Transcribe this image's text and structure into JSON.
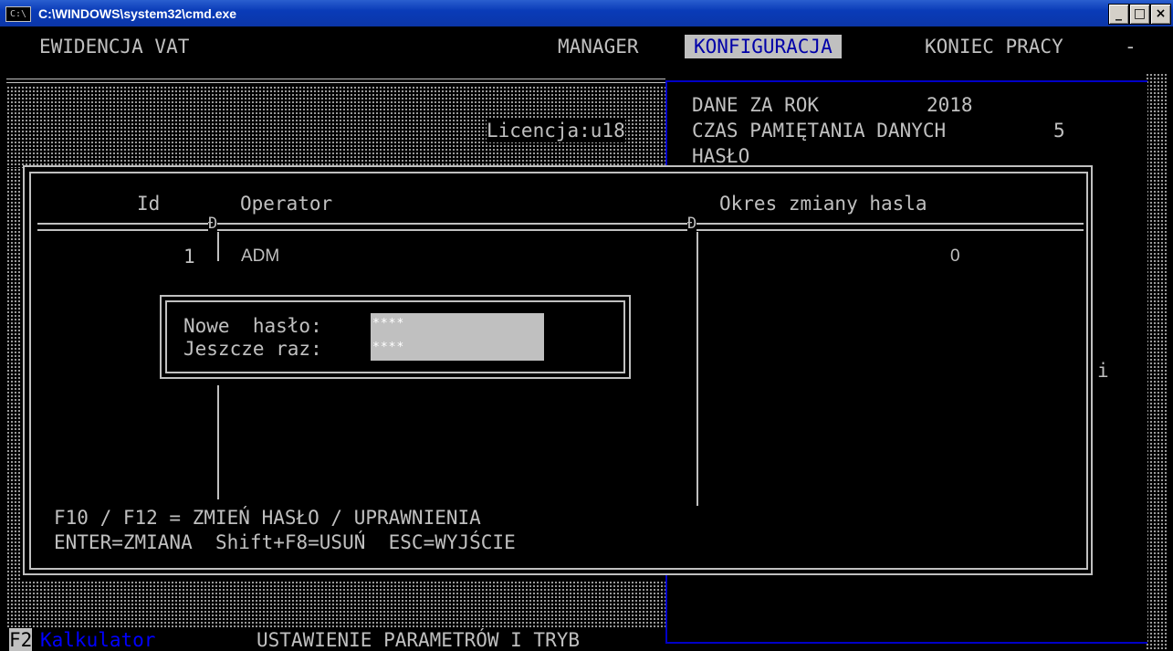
{
  "window": {
    "title": "C:\\WINDOWS\\system32\\cmd.exe",
    "icon_text": "C:\\",
    "minimize": "_",
    "maximize": "□",
    "close": "×"
  },
  "menu": {
    "app": "EWIDENCJA VAT",
    "manager": "MANAGER",
    "konfiguracja": "KONFIGURACJA",
    "koniec": "KONIEC PRACY",
    "dash": "-"
  },
  "licence": "Licencja:u18",
  "config": {
    "year_label": "DANE ZA ROK",
    "year_value": "2018",
    "retention_label": "CZAS PAMIĘTANIA DANYCH",
    "retention_value": "5",
    "password_label": "HASŁO",
    "side_char": "i"
  },
  "table": {
    "headers": {
      "id": "Id",
      "operator": "Operator",
      "period": "Okres zmiany hasla"
    },
    "separator_char": "Đ",
    "rows": [
      {
        "id": "1",
        "operator": "ADM",
        "period": "0"
      }
    ]
  },
  "password_dialog": {
    "new_label": "Nowe  hasło:",
    "new_value": "****",
    "repeat_label": "Jeszcze raz:",
    "repeat_value": "****"
  },
  "help": {
    "line1": "F10 / F12 = ZMIEŃ HASŁO / UPRAWNIENIA",
    "line2": "ENTER=ZMIANA  Shift+F8=USUŃ  ESC=WYJŚCIE"
  },
  "status": {
    "f2": "F2",
    "calculator": "Kalkulator",
    "mode": "USTAWIENIE PARAMETRÓW I TRYB"
  },
  "colors": {
    "title_blue": "#0b3ab3",
    "console_gray": "#c0c0c0",
    "panel_blue": "#0000c8",
    "link_blue": "#0000ff"
  }
}
